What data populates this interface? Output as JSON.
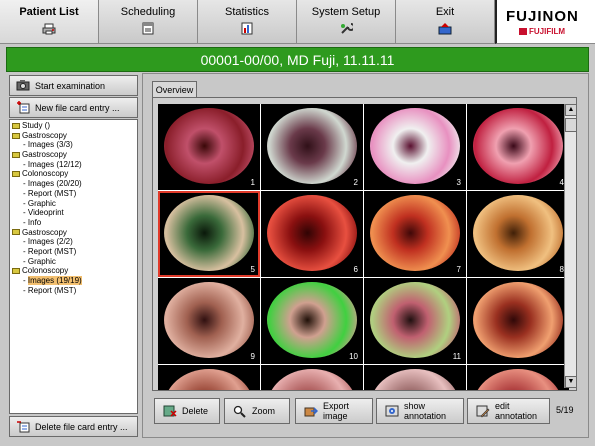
{
  "topnav": {
    "items": [
      {
        "label": "Patient List",
        "icon": "printer-icon",
        "active": true
      },
      {
        "label": "Scheduling",
        "icon": "calendar-icon",
        "active": false
      },
      {
        "label": "Statistics",
        "icon": "bar-chart-icon",
        "active": false
      },
      {
        "label": "System Setup",
        "icon": "wrench-icon",
        "active": false
      },
      {
        "label": "Exit",
        "icon": "exit-icon",
        "active": false
      }
    ],
    "brand": "FUJINON",
    "brand_sub": "FUJIFILM"
  },
  "patient_header": "00001-00/00, MD  Fuji,  11.11.11",
  "left_panel": {
    "start_button": "Start examination",
    "new_card_button": "New file card entry ...",
    "delete_card_button": "Delete file card entry ...",
    "tree": [
      {
        "text": "Study ()",
        "level": 0,
        "folder": true,
        "selected": false
      },
      {
        "text": "Gastroscopy",
        "level": 0,
        "folder": true,
        "selected": false
      },
      {
        "text": "Images (3/3)",
        "level": 1,
        "folder": false,
        "selected": false
      },
      {
        "text": "Gastroscopy",
        "level": 0,
        "folder": true,
        "selected": false
      },
      {
        "text": "Images (12/12)",
        "level": 1,
        "folder": false,
        "selected": false
      },
      {
        "text": "Colonoscopy",
        "level": 0,
        "folder": true,
        "selected": false
      },
      {
        "text": "Images (20/20)",
        "level": 1,
        "folder": false,
        "selected": false
      },
      {
        "text": "Report (MST)",
        "level": 1,
        "folder": false,
        "selected": false
      },
      {
        "text": "Graphic",
        "level": 1,
        "folder": false,
        "selected": false
      },
      {
        "text": "Videoprint",
        "level": 1,
        "folder": false,
        "selected": false
      },
      {
        "text": "Info",
        "level": 1,
        "folder": false,
        "selected": false
      },
      {
        "text": "Gastroscopy",
        "level": 0,
        "folder": true,
        "selected": false
      },
      {
        "text": "Images (2/2)",
        "level": 1,
        "folder": false,
        "selected": false
      },
      {
        "text": "Report (MST)",
        "level": 1,
        "folder": false,
        "selected": false
      },
      {
        "text": "Graphic",
        "level": 1,
        "folder": false,
        "selected": false
      },
      {
        "text": "Colonoscopy",
        "level": 0,
        "folder": true,
        "selected": false
      },
      {
        "text": "Images (19/19)",
        "level": 1,
        "folder": false,
        "selected": true
      },
      {
        "text": "Report (MST)",
        "level": 1,
        "folder": false,
        "selected": false
      }
    ]
  },
  "overview": {
    "tab_label": "Overview",
    "thumbnails": [
      {
        "number": "1",
        "colors": [
          "#8a1e2a",
          "#c0506a",
          "#3a0808"
        ],
        "selected": false
      },
      {
        "number": "2",
        "colors": [
          "#d0d8d0",
          "#6a3a4a",
          "#301018"
        ],
        "selected": false
      },
      {
        "number": "3",
        "colors": [
          "#e890c0",
          "#f0f0f0",
          "#5a1030"
        ],
        "selected": false
      },
      {
        "number": "4",
        "colors": [
          "#c02040",
          "#f0a0b0",
          "#3a0818"
        ],
        "selected": false
      },
      {
        "number": "5",
        "colors": [
          "#d8c0a0",
          "#3a6a3a",
          "#0a180a"
        ],
        "selected": true
      },
      {
        "number": "6",
        "colors": [
          "#e85040",
          "#8a1010",
          "#300404"
        ],
        "selected": false
      },
      {
        "number": "7",
        "colors": [
          "#f09050",
          "#c03020",
          "#400808"
        ],
        "selected": false
      },
      {
        "number": "8",
        "colors": [
          "#f0c080",
          "#c07030",
          "#402008"
        ],
        "selected": false
      },
      {
        "number": "9",
        "colors": [
          "#e0b0a0",
          "#a06050",
          "#301010"
        ],
        "selected": false
      },
      {
        "number": "10",
        "colors": [
          "#40d040",
          "#d0a090",
          "#201008"
        ],
        "selected": false
      },
      {
        "number": "11",
        "colors": [
          "#b0d080",
          "#c06070",
          "#201010"
        ],
        "selected": false
      },
      {
        "number": "",
        "colors": [
          "#f0a070",
          "#9a3020",
          "#300808"
        ],
        "selected": false
      },
      {
        "number": "",
        "colors": [
          "#e0a090",
          "#a05040",
          "#300808"
        ],
        "selected": false
      },
      {
        "number": "",
        "colors": [
          "#e8b0b0",
          "#b06060",
          "#301010"
        ],
        "selected": false
      },
      {
        "number": "",
        "colors": [
          "#e8c0c0",
          "#a07070",
          "#301818"
        ],
        "selected": false
      },
      {
        "number": "",
        "colors": [
          "#e89080",
          "#b04040",
          "#300808"
        ],
        "selected": false
      }
    ]
  },
  "actions": {
    "delete": "Delete",
    "zoom": "Zoom",
    "export": "Export image",
    "show_annotation": "show annotation",
    "edit_annotation": "edit annotation",
    "pager": "5/19"
  }
}
